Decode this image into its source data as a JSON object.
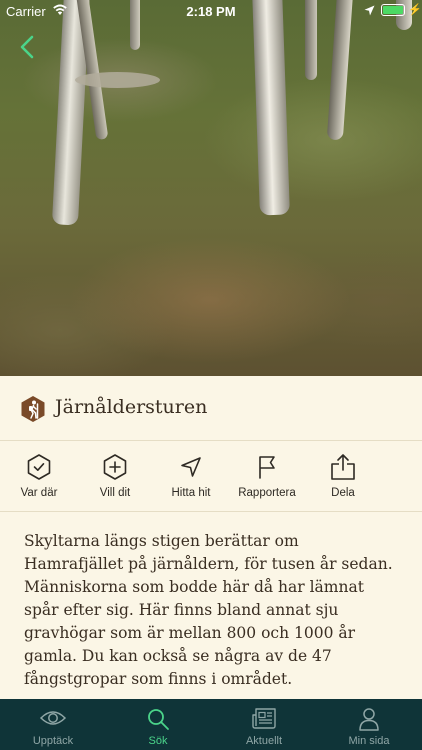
{
  "status_bar": {
    "carrier": "Carrier",
    "time": "2:18 PM",
    "battery_level": 1.0,
    "battery_color": "#4cd964"
  },
  "nav": {
    "back_icon": "chevron-left-icon",
    "accent": "#4bd48a"
  },
  "hero": {
    "image_icon": "forest-photo"
  },
  "poi": {
    "icon": "hiker-hexagon-icon",
    "icon_color": "#7a4a28",
    "title": "Järnåldersturen"
  },
  "actions": [
    {
      "id": "visited",
      "label": "Var där",
      "icon": "check-hexagon-icon"
    },
    {
      "id": "want",
      "label": "Vill dit",
      "icon": "plus-hexagon-icon"
    },
    {
      "id": "find",
      "label": "Hitta hit",
      "icon": "navigation-arrow-icon"
    },
    {
      "id": "report",
      "label": "Rapportera",
      "icon": "flag-icon"
    },
    {
      "id": "share",
      "label": "Dela",
      "icon": "share-icon"
    }
  ],
  "description": "Skyltarna längs stigen berättar om Hamrafjället på järnåldern, för tusen år sedan. Människorna som bodde här då har lämnat spår efter sig. Här finns bland annat sju gravhögar som är mellan 800 och 1000 år gamla. Du kan också se några av de 47 fångstgropar som finns i området.",
  "tabs": [
    {
      "id": "discover",
      "label": "Upptäck",
      "icon": "eye-icon",
      "active": false
    },
    {
      "id": "search",
      "label": "Sök",
      "icon": "search-icon",
      "active": true
    },
    {
      "id": "news",
      "label": "Aktuellt",
      "icon": "newspaper-icon",
      "active": false
    },
    {
      "id": "profile",
      "label": "Min sida",
      "icon": "person-icon",
      "active": false
    }
  ],
  "colors": {
    "tabbar_bg": "#0f3438",
    "active_tab": "#4bd48a",
    "inactive_tab": "#8fa6a6",
    "content_bg": "#fbf6e6"
  }
}
